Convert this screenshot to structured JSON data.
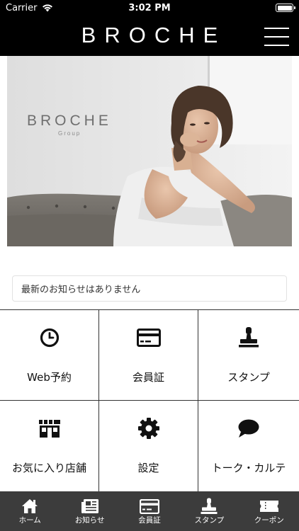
{
  "status_bar": {
    "carrier": "Carrier",
    "time": "3:02 PM"
  },
  "header": {
    "brand": "BROCHE"
  },
  "hero": {
    "wall_logo": "BROCHE",
    "wall_logo_sub": "Group"
  },
  "news": {
    "text": "最新のお知らせはありません"
  },
  "grid": {
    "items": [
      {
        "label": "Web予約",
        "icon": "clock-icon"
      },
      {
        "label": "会員証",
        "icon": "card-icon"
      },
      {
        "label": "スタンプ",
        "icon": "stamp-icon"
      },
      {
        "label": "お気に入り店舗",
        "icon": "store-icon"
      },
      {
        "label": "設定",
        "icon": "gear-icon"
      },
      {
        "label": "トーク・カルテ",
        "icon": "chat-icon"
      }
    ]
  },
  "tab_bar": {
    "items": [
      {
        "label": "ホーム",
        "icon": "home-icon"
      },
      {
        "label": "お知らせ",
        "icon": "news-icon"
      },
      {
        "label": "会員証",
        "icon": "card-icon"
      },
      {
        "label": "スタンプ",
        "icon": "stamp-icon"
      },
      {
        "label": "クーポン",
        "icon": "ticket-icon"
      }
    ]
  },
  "colors": {
    "header_bg": "#000000",
    "tab_bar_bg": "#3c3c3c",
    "grid_border": "#333333",
    "icon_color": "#111111"
  }
}
